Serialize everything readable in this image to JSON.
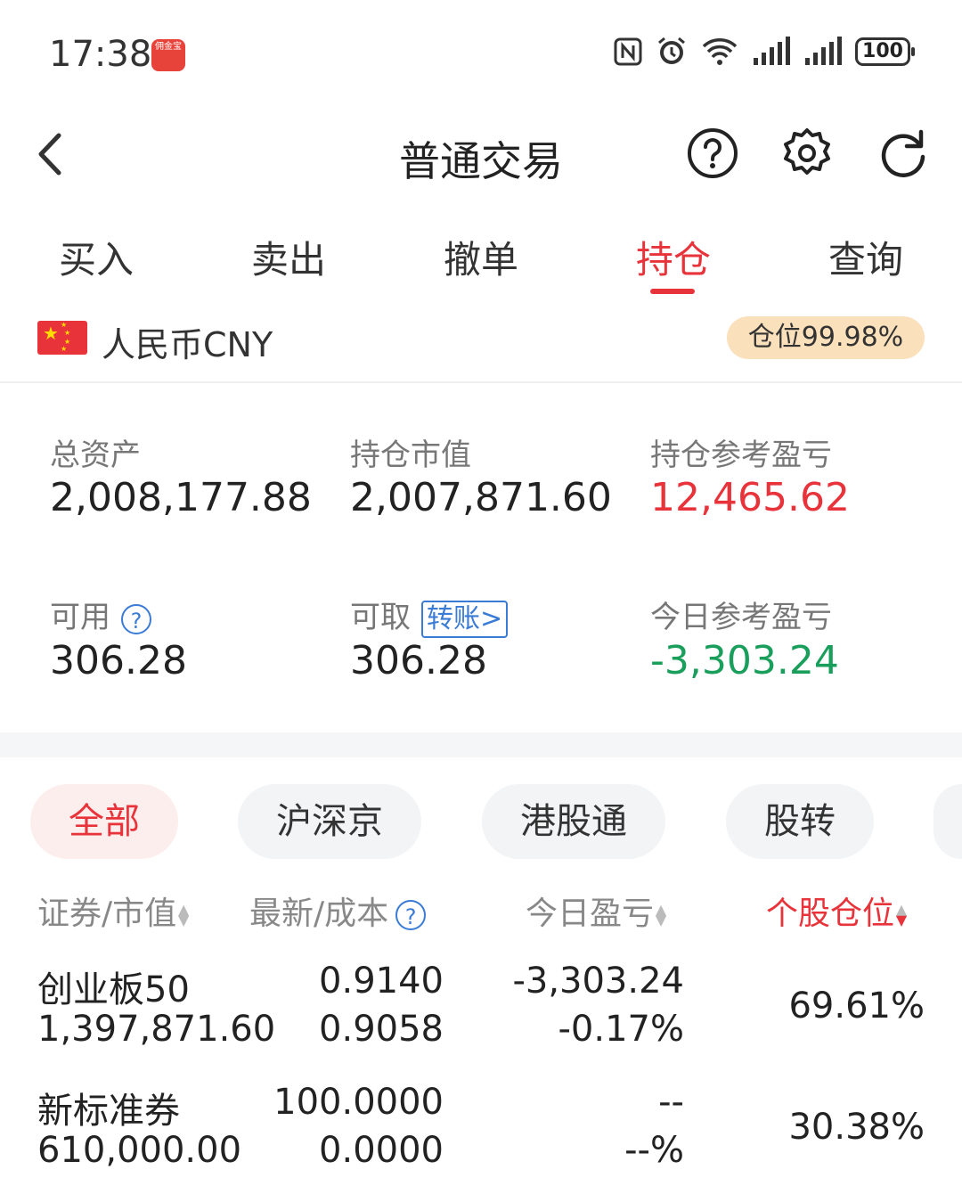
{
  "status_bar": {
    "time": "17:38",
    "app_badge": "佣金宝",
    "battery": "100",
    "icons": [
      "nfc-icon",
      "alarm-icon",
      "wifi-icon",
      "signal-icon",
      "signal-icon",
      "battery-icon"
    ]
  },
  "header": {
    "title": "普通交易",
    "icons": [
      "back-icon",
      "help-icon",
      "settings-icon",
      "refresh-icon"
    ]
  },
  "tabs": [
    {
      "label": "买入",
      "active": false
    },
    {
      "label": "卖出",
      "active": false
    },
    {
      "label": "撤单",
      "active": false
    },
    {
      "label": "持仓",
      "active": true
    },
    {
      "label": "查询",
      "active": false
    }
  ],
  "account": {
    "currency": "人民币CNY",
    "position_ratio": "仓位99.98%"
  },
  "stats": {
    "total_assets_label": "总资产",
    "total_assets": "2,008,177.88",
    "market_value_label": "持仓市值",
    "market_value": "2,007,871.60",
    "hold_pnl_label": "持仓参考盈亏",
    "hold_pnl": "12,465.62",
    "available_label": "可用",
    "available": "306.28",
    "withdrawable_label": "可取",
    "withdrawable": "306.28",
    "transfer_label": "转账>",
    "today_pnl_label": "今日参考盈亏",
    "today_pnl": "-3,303.24"
  },
  "filters": [
    "全部",
    "沪深京",
    "港股通",
    "股转"
  ],
  "columns": {
    "security": "证券/市值",
    "price": "最新/成本",
    "today_pnl": "今日盈亏",
    "weight": "个股仓位"
  },
  "holdings": [
    {
      "name": "创业板50",
      "market_value": "1,397,871.60",
      "latest": "0.9140",
      "cost": "0.9058",
      "pnl": "-3,303.24",
      "pnl_pct": "-0.17%",
      "weight": "69.61%"
    },
    {
      "name": "新标准券",
      "market_value": "610,000.00",
      "latest": "100.0000",
      "cost": "0.0000",
      "pnl": "--",
      "pnl_pct": "--%",
      "weight": "30.38%"
    }
  ],
  "colors": {
    "accent_red": "#e8333b",
    "loss_green": "#1a9e5b",
    "link_blue": "#3a7bd5",
    "badge_bg": "#fbe0bc"
  }
}
